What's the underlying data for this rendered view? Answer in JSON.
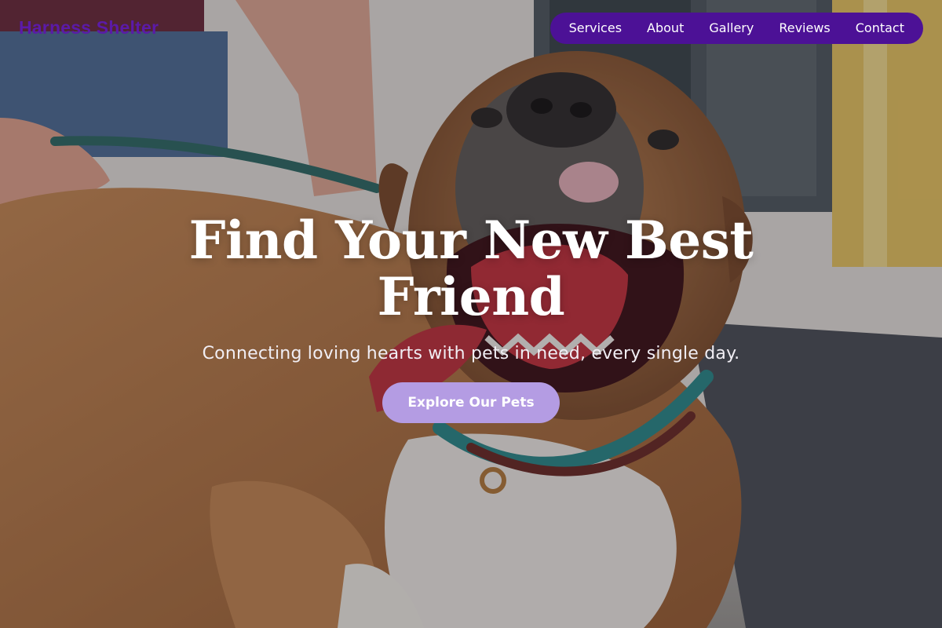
{
  "brand": {
    "name": "Harness Shelter"
  },
  "nav": {
    "items": [
      {
        "label": "Services"
      },
      {
        "label": "About"
      },
      {
        "label": "Gallery"
      },
      {
        "label": "Reviews"
      },
      {
        "label": "Contact"
      }
    ]
  },
  "hero": {
    "title": "Find Your New Best Friend",
    "subtitle": "Connecting loving hearts with pets in need, every single day.",
    "cta_label": "Explore Our Pets",
    "background_image": "smiling-dog-on-leash-photo"
  },
  "colors": {
    "brand_purple": "#5b1aa8",
    "nav_background": "#4c1196",
    "cta_background": "#b49ce3",
    "text_light": "#ffffff"
  }
}
